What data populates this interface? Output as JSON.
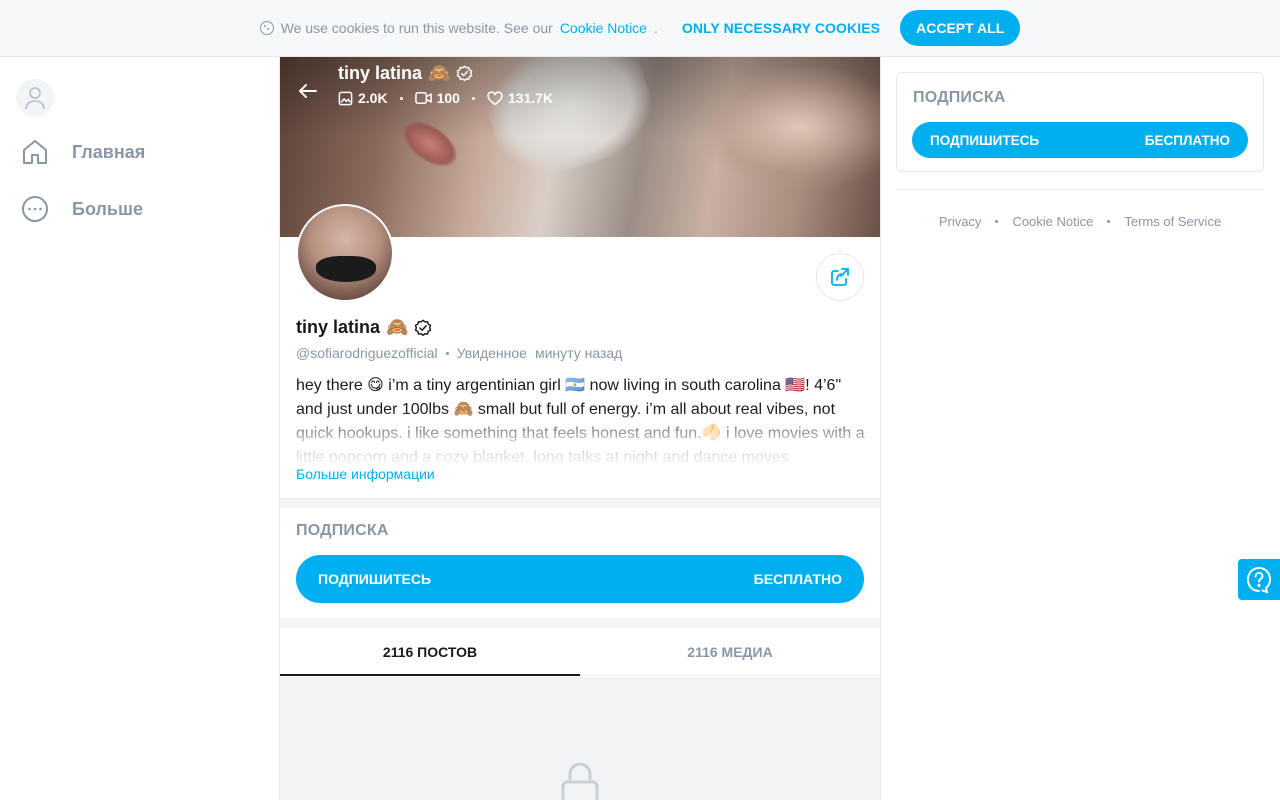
{
  "cookie_bar": {
    "text": "We use cookies to run this website. See our",
    "link": "Cookie Notice",
    "suffix": ".",
    "necessary_label": "ONLY NECESSARY COOKIES",
    "accept_label": "ACCEPT ALL",
    "icon": "cookie-icon"
  },
  "sidebar": {
    "items": [
      {
        "label": "Главная",
        "icon": "home-icon"
      },
      {
        "label": "Больше",
        "icon": "more-dots-icon"
      }
    ]
  },
  "profile": {
    "name": "tiny latina",
    "emoji": "🙈",
    "handle": "@sofiarodriguezofficial",
    "seen_label": "Увиденное",
    "seen_time": "минуту назад",
    "stats": {
      "photos": "2.0K",
      "videos": "100",
      "likes": "131.7K"
    },
    "bio": "hey there 😋 i’m a tiny argentinian girl 🇦🇷 now living in south carolina 🇺🇸! 4’6\" and just under 100lbs 🙈 small but full of energy. i’m all about real vibes, not quick hookups. i like something that feels honest and fun.🥠 i love movies with a little popcorn and a cozy blanket, long talks at night and dance moves",
    "more_info": "Больше информации"
  },
  "subscription": {
    "title": "ПОДПИСКА",
    "button_label": "ПОДПИШИТЕСЬ",
    "price": "БЕСПЛАТНО"
  },
  "tabs": [
    {
      "label": "2116 ПОСТОВ",
      "active": true
    },
    {
      "label": "2116 МЕДИА",
      "active": false
    }
  ],
  "right": {
    "subscription_title": "ПОДПИСКА",
    "button_label": "ПОДПИШИТЕСЬ",
    "price": "БЕСПЛАТНО",
    "footer": [
      "Privacy",
      "Cookie Notice",
      "Terms of Service"
    ]
  },
  "colors": {
    "accent": "#00aff0",
    "muted": "#8a96a3",
    "text": "#1a1a1a"
  }
}
